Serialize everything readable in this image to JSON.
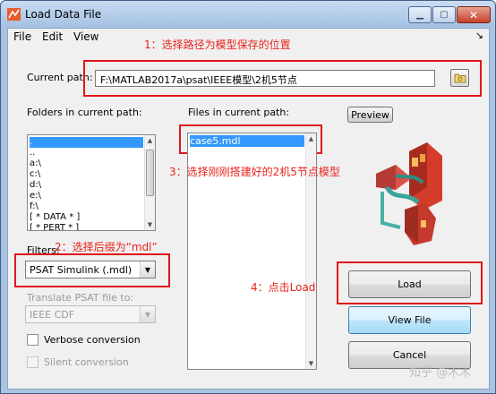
{
  "window": {
    "title": "Load Data File"
  },
  "menu": {
    "file": "File",
    "edit": "Edit",
    "view": "View",
    "dock_glyph": "↘"
  },
  "annotations": {
    "step1": "1：选择路径为模型保存的位置",
    "step2": "2：选择后缀为“mdl”",
    "step3": "3：选择刚刚搭建好的2机5节点模型",
    "step4": "4：点击Load"
  },
  "current_path": {
    "label": "Current path:",
    "value": "F:\\MATLAB2017a\\psat\\IEEE模型\\2机5节点"
  },
  "folders": {
    "label": "Folders in current path:",
    "items": [
      ".",
      "..",
      "a:\\",
      "c:\\",
      "d:\\",
      "e:\\",
      "f:\\",
      "[ * DATA * ]",
      "[ * PERT * ]"
    ],
    "selected_index": 0
  },
  "files": {
    "label": "Files in current path:",
    "items": [
      "case5.mdl"
    ],
    "selected_index": 0
  },
  "filters": {
    "label": "Filters:",
    "selected": "PSAT Simulink (.mdl)"
  },
  "translate": {
    "label": "Translate PSAT file to:",
    "selected": "IEEE CDF"
  },
  "checkboxes": {
    "verbose": "Verbose conversion",
    "silent": "Silent conversion"
  },
  "buttons": {
    "preview": "Preview",
    "load": "Load",
    "view_file": "View File",
    "cancel": "Cancel"
  },
  "watermark": "知乎 @木木",
  "colors": {
    "annotation_red": "#e0161a",
    "selection_blue": "#3399ff"
  }
}
